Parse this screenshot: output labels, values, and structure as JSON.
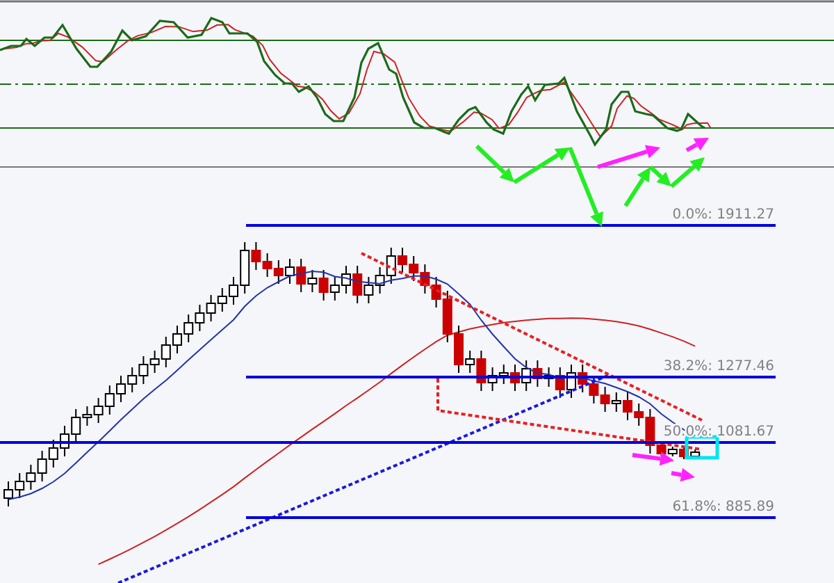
{
  "chart": {
    "fibonacci_levels": [
      {
        "label": "0.0%: 1911.27"
      },
      {
        "label": "38.2%: 1277.46"
      },
      {
        "label": "50.0%: 1081.67"
      },
      {
        "label": "61.8%: 885.89"
      }
    ]
  }
}
